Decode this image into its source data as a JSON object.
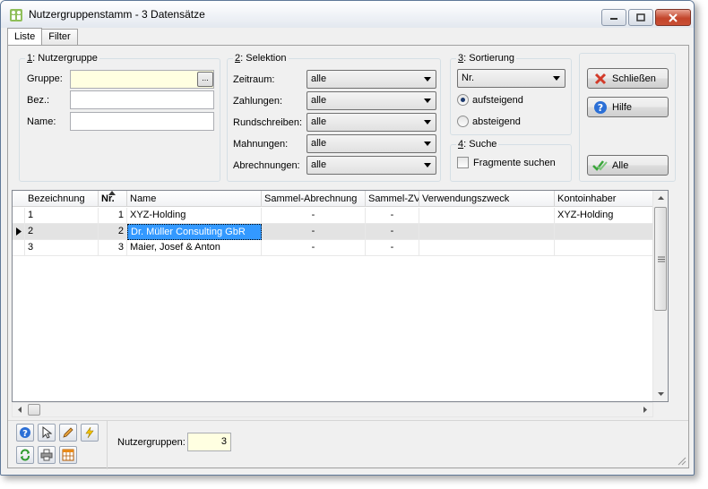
{
  "window": {
    "title": "Nutzergruppenstamm - 3 Datensätze"
  },
  "tabs": [
    {
      "label": "Liste",
      "active": true
    },
    {
      "label": "Filter",
      "active": false
    }
  ],
  "group1": {
    "key": "1",
    "title_rest": ": Nutzergruppe",
    "gruppe_label": "Gruppe:",
    "gruppe_value": "",
    "ellipsis": "...",
    "bez_label": "Bez.:",
    "bez_value": "",
    "name_label": "Name:",
    "name_value": ""
  },
  "group2": {
    "key": "2",
    "title_rest": ": Selektion",
    "rows": [
      {
        "label": "Zeitraum:",
        "value": "alle"
      },
      {
        "label": "Zahlungen:",
        "value": "alle"
      },
      {
        "label": "Rundschreiben:",
        "value": "alle"
      },
      {
        "label": "Mahnungen:",
        "value": "alle"
      },
      {
        "label": "Abrechnungen:",
        "value": "alle"
      }
    ]
  },
  "group3": {
    "key": "3",
    "title_rest": ": Sortierung",
    "sort_value": "Nr.",
    "ascending": "aufsteigend",
    "descending": "absteigend",
    "selected": "aufsteigend"
  },
  "group4": {
    "key": "4",
    "title_rest": ": Suche",
    "fragments_label": "Fragmente suchen",
    "fragments_checked": false
  },
  "buttons": {
    "close": "Schließen",
    "help": "Hilfe",
    "all": "Alle"
  },
  "grid": {
    "columns": [
      "Bezeichnung",
      "Nr.",
      "Name",
      "Sammel-Abrechnung",
      "Sammel-ZV",
      "Verwendungszweck",
      "Kontoinhaber"
    ],
    "rows": [
      {
        "bez": "1",
        "nr": "1",
        "name": "XYZ-Holding",
        "sammel_abr": "-",
        "sammel_zv": "-",
        "zweck": "",
        "inhaber": "XYZ-Holding"
      },
      {
        "bez": "2",
        "nr": "2",
        "name": "Dr. Müller Consulting GbR",
        "sammel_abr": "-",
        "sammel_zv": "-",
        "zweck": "",
        "inhaber": ""
      },
      {
        "bez": "3",
        "nr": "3",
        "name": "Maier, Josef & Anton",
        "sammel_abr": "-",
        "sammel_zv": "-",
        "zweck": "",
        "inhaber": ""
      }
    ],
    "selected_row": 1
  },
  "footer": {
    "count_label": "Nutzergruppen:",
    "count_value": "3"
  },
  "colors": {
    "accent_selection": "#3399ff",
    "input_yellow": "#ffffe1",
    "close_red": "#c3452b"
  }
}
